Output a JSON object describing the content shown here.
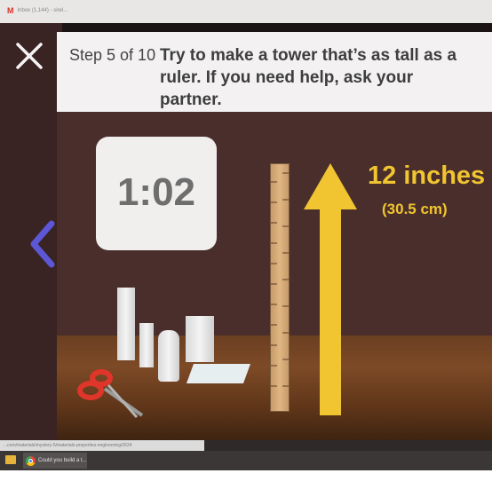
{
  "browser": {
    "tab_title": "Inbox (1,144) - sirel...",
    "gmail_glyph": "M",
    "url": "...com/materials/mystery-5/materials-properties-engineering/2624"
  },
  "lesson": {
    "step_label": "Step 5 of 10",
    "instruction": "Try to make a tower that’s as tall as a ruler. If you need help, ask your partner.",
    "timer": "1:02",
    "height_label": "12 inches",
    "height_metric": "(30.5 cm)"
  },
  "colors": {
    "accent_yellow": "#f0c531",
    "nav_arrow": "#5b57d6"
  },
  "icons": {
    "close": "close-icon",
    "back": "chevron-left-icon"
  },
  "taskbar": {
    "item_label": "Could you build a t..."
  }
}
